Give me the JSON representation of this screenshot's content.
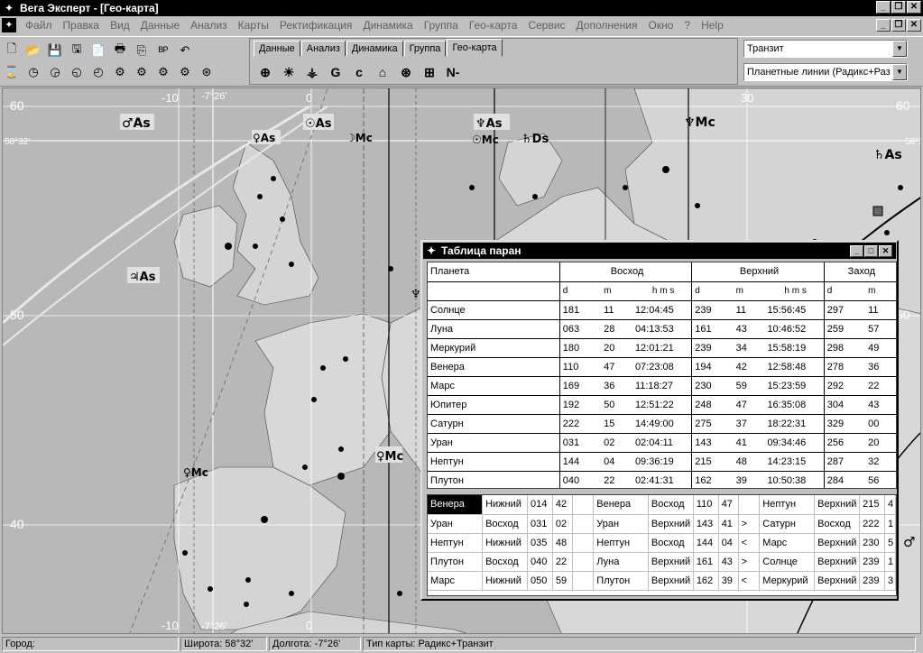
{
  "window": {
    "title": "Вега Эксперт - [Гео-карта]",
    "app_icon": "star-icon"
  },
  "menu": [
    "Файл",
    "Правка",
    "Вид",
    "Данные",
    "Анализ",
    "Карты",
    "Ректификация",
    "Динамика",
    "Группа",
    "Гео-карта",
    "Сервис",
    "Дополнения",
    "Окно",
    "?",
    "Help"
  ],
  "toolbar": {
    "row1_icons": [
      "new-file-icon",
      "open-folder-icon",
      "save-icon",
      "save-as-icon",
      "document-icon",
      "print-icon",
      "copy-icon",
      "bp-icon",
      "undo-icon"
    ],
    "row1_glyphs": [
      "🗋",
      "📂",
      "💾",
      "🖫",
      "📄",
      "🖶",
      "⎘",
      "ᴮᴾ",
      "↶"
    ],
    "row2_icons": [
      "hourglass-icon",
      "clock-icon",
      "clock-2-icon",
      "clock-3-icon",
      "clock-4-icon",
      "chart-tools-icon",
      "chart-tools-2-icon",
      "chart-tools-3-icon",
      "chart-tools-4-icon",
      "wheel-icon"
    ],
    "row2_glyphs": [
      "⌛",
      "◷",
      "◶",
      "◵",
      "◴",
      "⚙",
      "⚙",
      "⚙",
      "⚙",
      "⊛"
    ]
  },
  "tabs": [
    "Данные",
    "Анализ",
    "Динамика",
    "Группа",
    "Гео-карта"
  ],
  "active_tab": "Гео-карта",
  "tab_icons": [
    "globe-icon",
    "sun-icon",
    "astro-symbol-icon",
    "g-letter-icon",
    "c-letter-icon",
    "house-icon",
    "network-icon",
    "chart-icon",
    "n-minus-icon"
  ],
  "tab_glyphs": [
    "⊕",
    "☀",
    "⚶",
    "G",
    "c",
    "⌂",
    "⊛",
    "⊞",
    "N-"
  ],
  "combos": {
    "mode": "Транзит",
    "lines": "Планетные линии (Радикс+Раз"
  },
  "map": {
    "lat_labels": [
      "60",
      "50",
      "40"
    ],
    "lon_labels": [
      "-10",
      "0",
      "30"
    ],
    "lon_labels_top": [
      "-10",
      "-7°26'",
      "0",
      "30"
    ],
    "lon_labels_bottom": [
      "-10",
      "-7°26'",
      "0"
    ],
    "lat_mark": "58°32'",
    "planet_labels": [
      "♂As",
      "☉As",
      "♆As",
      "☽Mc",
      "☉Mc",
      "♄Ds",
      "♀As",
      "♃As",
      "♀Mc",
      "♀Mc",
      "♆As",
      "♄As",
      "♆Mc",
      "♂"
    ]
  },
  "dialog": {
    "title": "Таблица паран",
    "headers": [
      "Планета",
      "Восход",
      "Верхний",
      "Заход"
    ],
    "subheaders": [
      "d",
      "m",
      "h m s"
    ],
    "rows": [
      [
        "Солнце",
        "181",
        "11",
        "12:04:45",
        "239",
        "11",
        "15:56:45",
        "297",
        "11"
      ],
      [
        "Луна",
        "063",
        "28",
        "04:13:53",
        "161",
        "43",
        "10:46:52",
        "259",
        "57"
      ],
      [
        "Меркурий",
        "180",
        "20",
        "12:01:21",
        "239",
        "34",
        "15:58:19",
        "298",
        "49"
      ],
      [
        "Венера",
        "110",
        "47",
        "07:23:08",
        "194",
        "42",
        "12:58:48",
        "278",
        "36"
      ],
      [
        "Марс",
        "169",
        "36",
        "11:18:27",
        "230",
        "59",
        "15:23:59",
        "292",
        "22"
      ],
      [
        "Юпитер",
        "192",
        "50",
        "12:51:22",
        "248",
        "47",
        "16:35:08",
        "304",
        "43"
      ],
      [
        "Сатурн",
        "222",
        "15",
        "14:49:00",
        "275",
        "37",
        "18:22:31",
        "329",
        "00"
      ],
      [
        "Уран",
        "031",
        "02",
        "02:04:11",
        "143",
        "41",
        "09:34:46",
        "256",
        "20"
      ],
      [
        "Нептун",
        "144",
        "04",
        "09:36:19",
        "215",
        "48",
        "14:23:15",
        "287",
        "32"
      ],
      [
        "Плутон",
        "040",
        "22",
        "02:41:31",
        "162",
        "39",
        "10:50:38",
        "284",
        "56"
      ]
    ],
    "parans": [
      [
        "Венера",
        "Нижний",
        "014",
        "42",
        "",
        "Венера",
        "Восход",
        "110",
        "47",
        "",
        "Нептун",
        "Верхний",
        "215",
        "4"
      ],
      [
        "Уран",
        "Восход",
        "031",
        "02",
        "",
        "Уран",
        "Верхний",
        "143",
        "41",
        ">",
        "Сатурн",
        "Восход",
        "222",
        "1"
      ],
      [
        "Нептун",
        "Нижний",
        "035",
        "48",
        "",
        "Нептун",
        "Восход",
        "144",
        "04",
        "<",
        "Марс",
        "Верхний",
        "230",
        "5"
      ],
      [
        "Плутон",
        "Восход",
        "040",
        "22",
        "",
        "Луна",
        "Верхний",
        "161",
        "43",
        ">",
        "Солнце",
        "Верхний",
        "239",
        "1"
      ],
      [
        "Марс",
        "Нижний",
        "050",
        "59",
        "",
        "Плутон",
        "Верхний",
        "162",
        "39",
        "<",
        "Меркурий",
        "Верхний",
        "239",
        "3"
      ]
    ]
  },
  "status": {
    "city": "Город:",
    "lat_label": "Широта:",
    "lat_value": "58°32'",
    "lon_label": "Долгота:",
    "lon_value": "-7°26'",
    "type_label": "Тип карты:",
    "type_value": "Радикс+Транзит"
  }
}
